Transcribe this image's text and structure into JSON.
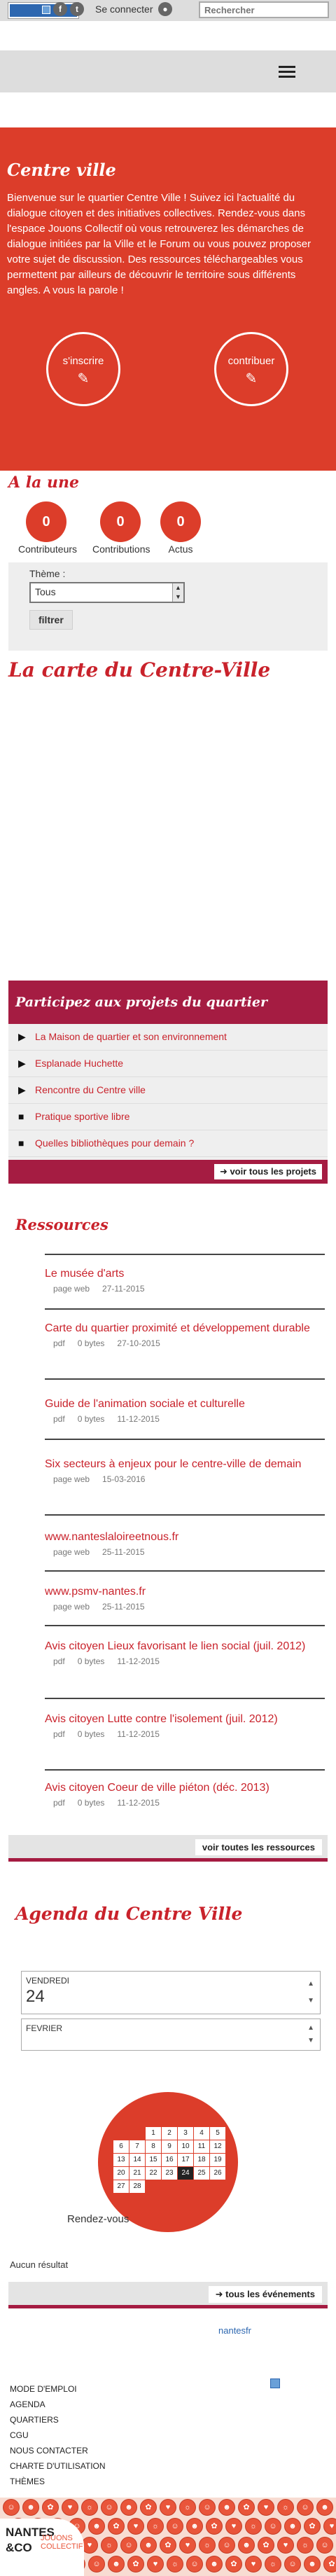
{
  "topbar": {
    "facebook_icon": "f",
    "twitter_icon": "t",
    "connect_label": "Se connecter",
    "user_icon": "user-icon",
    "search_placeholder": "Rechercher"
  },
  "hero": {
    "title": "Centre ville",
    "intro": "Bienvenue sur le quartier Centre Ville ! Suivez ici l'actualité du dialogue citoyen et des initiatives collectives. Rendez-vous dans l'espace Jouons Collectif où vous retrouverez les démarches de dialogue initiées par la Ville et le Forum ou vous pouvez proposer votre sujet de discussion. Des ressources téléchargeables vous permettent par ailleurs de découvrir le territoire sous différents angles. A vous la parole !",
    "signup_label": "s'inscrire",
    "contribute_label": "contribuer"
  },
  "une": {
    "title": "A la une",
    "stats": [
      {
        "value": "0",
        "label": "Contributeurs"
      },
      {
        "value": "0",
        "label": "Contributions"
      },
      {
        "value": "0",
        "label": "Actus"
      }
    ]
  },
  "filter": {
    "theme_label": "Thème :",
    "theme_value": "Tous",
    "filter_button": "filtrer"
  },
  "map": {
    "title": "La carte du Centre-Ville"
  },
  "projects": {
    "title": "Participez aux projets du quartier",
    "items": [
      {
        "icon": "▶",
        "label": "La Maison de quartier et son environnement"
      },
      {
        "icon": "▶",
        "label": "Esplanade Huchette"
      },
      {
        "icon": "▶",
        "label": "Rencontre du Centre ville"
      },
      {
        "icon": "■",
        "label": "Pratique sportive libre"
      },
      {
        "icon": "■",
        "label": "Quelles bibliothèques pour demain ?"
      }
    ],
    "see_all": "voir tous les projets"
  },
  "resources": {
    "title": "Ressources",
    "items": [
      {
        "title": "Le musée d'arts",
        "type": "page web",
        "size": "",
        "date": "27-11-2015"
      },
      {
        "title": "Carte du quartier proximité et développement durable",
        "type": "pdf",
        "size": "0 bytes",
        "date": "27-10-2015"
      },
      {
        "title": "Guide de l'animation sociale et culturelle",
        "type": "pdf",
        "size": "0 bytes",
        "date": "11-12-2015"
      },
      {
        "title": "Six secteurs à enjeux pour le centre-ville de demain",
        "type": "page web",
        "size": "",
        "date": "15-03-2016"
      },
      {
        "title": "www.nanteslaloireetnous.fr",
        "type": "page web",
        "size": "",
        "date": "25-11-2015"
      },
      {
        "title": "www.psmv-nantes.fr",
        "type": "page web",
        "size": "",
        "date": "25-11-2015"
      },
      {
        "title": "Avis citoyen Lieux favorisant le lien social (juil. 2012)",
        "type": "pdf",
        "size": "0 bytes",
        "date": "11-12-2015"
      },
      {
        "title": "Avis citoyen Lutte contre l'isolement (juil. 2012)",
        "type": "pdf",
        "size": "0 bytes",
        "date": "11-12-2015"
      },
      {
        "title": "Avis citoyen Coeur de ville piéton (déc. 2013)",
        "type": "pdf",
        "size": "0 bytes",
        "date": "11-12-2015"
      }
    ],
    "see_all": "voir toutes les ressources"
  },
  "agenda": {
    "title": "Agenda du Centre Ville",
    "day_label": "VENDREDI",
    "day_value": "24",
    "month_label": "FEVRIER",
    "calendar_days": [
      "",
      "",
      "1",
      "2",
      "3",
      "4",
      "5",
      "6",
      "7",
      "8",
      "9",
      "10",
      "11",
      "12",
      "13",
      "14",
      "15",
      "16",
      "17",
      "18",
      "19",
      "20",
      "21",
      "22",
      "23",
      "24",
      "25",
      "26",
      "27",
      "28"
    ],
    "selected_day": "24",
    "rdv_label": "Rendez-vous",
    "no_result": "Aucun résultat",
    "see_all": "tous les événements"
  },
  "footer": {
    "links": [
      "MODE D'EMPLOI",
      "AGENDA",
      "QUARTIERS",
      "CGU",
      "NOUS CONTACTER",
      "CHARTE D'UTILISATION",
      "THÈMES"
    ],
    "nantes_link": "nantesfr",
    "logo_line1": "NANTES",
    "logo_line2": "&CO",
    "logo_line3": "JOUONS COLLECTIF"
  },
  "colors": {
    "red": "#dc3d2a",
    "dark_red": "#a51c42",
    "title_red": "#c9222b"
  }
}
